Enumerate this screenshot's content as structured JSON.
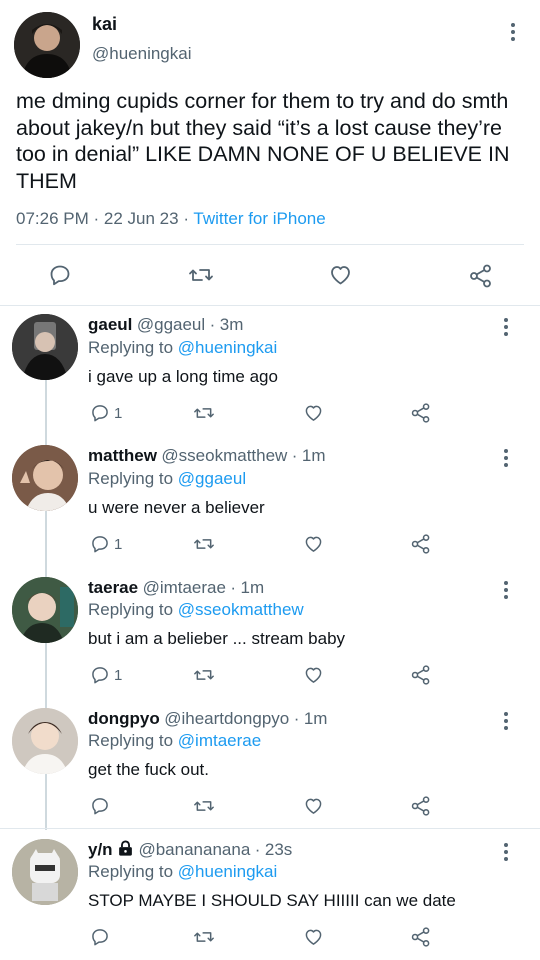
{
  "main_tweet": {
    "display_name": "kai",
    "handle": "@hueningkai",
    "text": "me dming cupids corner for them to try and do smth about jakey/n but they said “it’s a lost cause they’re too in denial” LIKE DAMN NONE OF U BELIEVE IN THEM",
    "time": "07:26 PM",
    "date": "22 Jun 23",
    "sep": "·",
    "source": "Twitter for iPhone"
  },
  "replies": [
    {
      "name": "gaeul",
      "handle": "@ggaeul",
      "age": "3m",
      "replying_label": "Replying to",
      "replying_to": "@hueningkai",
      "text": "i gave up a long time ago",
      "reply_count": "1",
      "avatar_color": "#2b2b2b"
    },
    {
      "name": "matthew",
      "handle": "@sseokmatthew",
      "age": "1m",
      "replying_label": "Replying to",
      "replying_to": "@ggaeul",
      "text": "u were never a believer",
      "reply_count": "1",
      "avatar_color": "#6b4a3a"
    },
    {
      "name": "taerae",
      "handle": "@imtaerae",
      "age": "1m",
      "replying_label": "Replying to",
      "replying_to": "@sseokmatthew",
      "text": "but i am a belieber ... stream baby",
      "reply_count": "1",
      "avatar_color": "#4a5a3a"
    },
    {
      "name": "dongpyo",
      "handle": "@iheartdongpyo",
      "age": "1m",
      "replying_label": "Replying to",
      "replying_to": "@imtaerae",
      "text": "get the fuck out.",
      "reply_count": "",
      "avatar_color": "#d8d2cc"
    },
    {
      "name": "y/n",
      "handle": "@banananana",
      "age": "23s",
      "replying_label": "Replying to",
      "replying_to": "@hueningkai",
      "text": "STOP MAYBE I SHOULD SAY HIIIII can we date",
      "reply_count": "",
      "avatar_color": "#9a9a8a"
    }
  ],
  "icons": [
    "reply-icon",
    "retweet-icon",
    "like-icon",
    "share-icon",
    "more-icon",
    "lock-icon"
  ]
}
